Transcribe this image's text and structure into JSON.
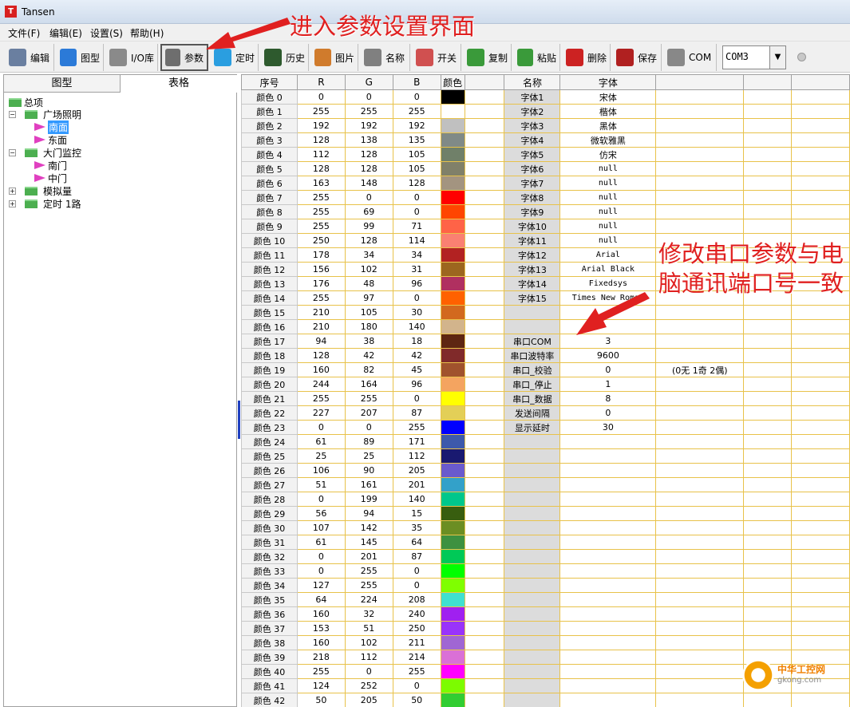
{
  "window": {
    "title": "Tansen",
    "app_icon_letter": "T"
  },
  "menu": [
    "文件(F)",
    "编辑(E)",
    "设置(S)",
    "帮助(H)"
  ],
  "toolbar": [
    {
      "label": "编辑",
      "icon": "edit-icon",
      "color": "#6a7fa0"
    },
    {
      "label": "图型",
      "icon": "globe-icon",
      "color": "#2b7ad8"
    },
    {
      "label": "I/O库",
      "icon": "database-icon",
      "color": "#8a8a8a"
    },
    {
      "label": "参数",
      "icon": "gear-icon",
      "color": "#6e6e6e"
    },
    {
      "label": "定时",
      "icon": "timer-icon",
      "color": "#2a9ee0"
    },
    {
      "label": "历史",
      "icon": "chart-icon",
      "color": "#2e5a2e"
    },
    {
      "label": "图片",
      "icon": "picture-icon",
      "color": "#d07b2c"
    },
    {
      "label": "名称",
      "icon": "rename-icon",
      "color": "#808080"
    },
    {
      "label": "开关",
      "icon": "switch-icon",
      "color": "#d05050"
    },
    {
      "label": "复制",
      "icon": "copy-icon",
      "color": "#3a9a3a"
    },
    {
      "label": "粘贴",
      "icon": "paste-icon",
      "color": "#3a9a3a"
    },
    {
      "label": "删除",
      "icon": "delete-icon",
      "color": "#cc2222"
    },
    {
      "label": "保存",
      "icon": "save-icon",
      "color": "#b02020"
    },
    {
      "label": "COM",
      "icon": "com-icon",
      "color": "#888888"
    }
  ],
  "com_port": "COM3",
  "left_tabs": [
    "图型",
    "表格"
  ],
  "tree": {
    "root": "总项",
    "groups": [
      {
        "label": "广场照明",
        "children": [
          "南面",
          "东面"
        ],
        "selected": "南面"
      },
      {
        "label": "大门监控",
        "children": [
          "南门",
          "中门"
        ]
      },
      {
        "label": "模拟量",
        "children": []
      },
      {
        "label": "定时 1路",
        "children": []
      }
    ]
  },
  "grid": {
    "headers": [
      "序号",
      "R",
      "G",
      "B",
      "颜色",
      "",
      "名称",
      "字体",
      "",
      "",
      ""
    ],
    "colors": [
      {
        "name": "颜色 0",
        "r": 0,
        "g": 0,
        "b": 0
      },
      {
        "name": "颜色 1",
        "r": 255,
        "g": 255,
        "b": 255
      },
      {
        "name": "颜色 2",
        "r": 192,
        "g": 192,
        "b": 192
      },
      {
        "name": "颜色 3",
        "r": 128,
        "g": 138,
        "b": 135
      },
      {
        "name": "颜色 4",
        "r": 112,
        "g": 128,
        "b": 105
      },
      {
        "name": "颜色 5",
        "r": 128,
        "g": 128,
        "b": 105
      },
      {
        "name": "颜色 6",
        "r": 163,
        "g": 148,
        "b": 128
      },
      {
        "name": "颜色 7",
        "r": 255,
        "g": 0,
        "b": 0
      },
      {
        "name": "颜色 8",
        "r": 255,
        "g": 69,
        "b": 0
      },
      {
        "name": "颜色 9",
        "r": 255,
        "g": 99,
        "b": 71
      },
      {
        "name": "颜色 10",
        "r": 250,
        "g": 128,
        "b": 114
      },
      {
        "name": "颜色 11",
        "r": 178,
        "g": 34,
        "b": 34
      },
      {
        "name": "颜色 12",
        "r": 156,
        "g": 102,
        "b": 31
      },
      {
        "name": "颜色 13",
        "r": 176,
        "g": 48,
        "b": 96
      },
      {
        "name": "颜色 14",
        "r": 255,
        "g": 97,
        "b": 0
      },
      {
        "name": "颜色 15",
        "r": 210,
        "g": 105,
        "b": 30
      },
      {
        "name": "颜色 16",
        "r": 210,
        "g": 180,
        "b": 140
      },
      {
        "name": "颜色 17",
        "r": 94,
        "g": 38,
        "b": 18
      },
      {
        "name": "颜色 18",
        "r": 128,
        "g": 42,
        "b": 42
      },
      {
        "name": "颜色 19",
        "r": 160,
        "g": 82,
        "b": 45
      },
      {
        "name": "颜色 20",
        "r": 244,
        "g": 164,
        "b": 96
      },
      {
        "name": "颜色 21",
        "r": 255,
        "g": 255,
        "b": 0
      },
      {
        "name": "颜色 22",
        "r": 227,
        "g": 207,
        "b": 87
      },
      {
        "name": "颜色 23",
        "r": 0,
        "g": 0,
        "b": 255
      },
      {
        "name": "颜色 24",
        "r": 61,
        "g": 89,
        "b": 171
      },
      {
        "name": "颜色 25",
        "r": 25,
        "g": 25,
        "b": 112
      },
      {
        "name": "颜色 26",
        "r": 106,
        "g": 90,
        "b": 205
      },
      {
        "name": "颜色 27",
        "r": 51,
        "g": 161,
        "b": 201
      },
      {
        "name": "颜色 28",
        "r": 0,
        "g": 199,
        "b": 140
      },
      {
        "name": "颜色 29",
        "r": 56,
        "g": 94,
        "b": 15
      },
      {
        "name": "颜色 30",
        "r": 107,
        "g": 142,
        "b": 35
      },
      {
        "name": "颜色 31",
        "r": 61,
        "g": 145,
        "b": 64
      },
      {
        "name": "颜色 32",
        "r": 0,
        "g": 201,
        "b": 87
      },
      {
        "name": "颜色 33",
        "r": 0,
        "g": 255,
        "b": 0
      },
      {
        "name": "颜色 34",
        "r": 127,
        "g": 255,
        "b": 0
      },
      {
        "name": "颜色 35",
        "r": 64,
        "g": 224,
        "b": 208
      },
      {
        "name": "颜色 36",
        "r": 160,
        "g": 32,
        "b": 240
      },
      {
        "name": "颜色 37",
        "r": 153,
        "g": 51,
        "b": 250
      },
      {
        "name": "颜色 38",
        "r": 160,
        "g": 102,
        "b": 211
      },
      {
        "name": "颜色 39",
        "r": 218,
        "g": 112,
        "b": 214
      },
      {
        "name": "颜色 40",
        "r": 255,
        "g": 0,
        "b": 255
      },
      {
        "name": "颜色 41",
        "r": 124,
        "g": 252,
        "b": 0
      },
      {
        "name": "颜色 42",
        "r": 50,
        "g": 205,
        "b": 50
      }
    ],
    "fonts": [
      {
        "name": "字体1",
        "value": "宋体"
      },
      {
        "name": "字体2",
        "value": "楷体"
      },
      {
        "name": "字体3",
        "value": "黑体"
      },
      {
        "name": "字体4",
        "value": "微软雅黑"
      },
      {
        "name": "字体5",
        "value": "仿宋"
      },
      {
        "name": "字体6",
        "value": "null"
      },
      {
        "name": "字体7",
        "value": "null"
      },
      {
        "name": "字体8",
        "value": "null"
      },
      {
        "name": "字体9",
        "value": "null"
      },
      {
        "name": "字体10",
        "value": "null"
      },
      {
        "name": "字体11",
        "value": "null"
      },
      {
        "name": "字体12",
        "value": "Arial"
      },
      {
        "name": "字体13",
        "value": "Arial Black"
      },
      {
        "name": "字体14",
        "value": "Fixedsys"
      },
      {
        "name": "字体15",
        "value": "Times New Roman"
      }
    ],
    "serial": [
      {
        "name": "串口COM",
        "value": "3",
        "note": ""
      },
      {
        "name": "串口波特率",
        "value": "9600",
        "note": ""
      },
      {
        "name": "串口_校验",
        "value": "0",
        "note": "(0无 1奇 2偶)"
      },
      {
        "name": "串口_停止",
        "value": "1",
        "note": ""
      },
      {
        "name": "串口_数据",
        "value": "8",
        "note": ""
      },
      {
        "name": "发送间隔",
        "value": "0",
        "note": ""
      },
      {
        "name": "显示延时",
        "value": "30",
        "note": ""
      }
    ]
  },
  "annotations": {
    "top": "进入参数设置界面",
    "right_line1": "修改串口参数与电",
    "right_line2": "脑通讯端口号一致",
    "color": "#e02020"
  },
  "watermark": {
    "line1": "中华工控网",
    "line2": "gkong.com"
  }
}
